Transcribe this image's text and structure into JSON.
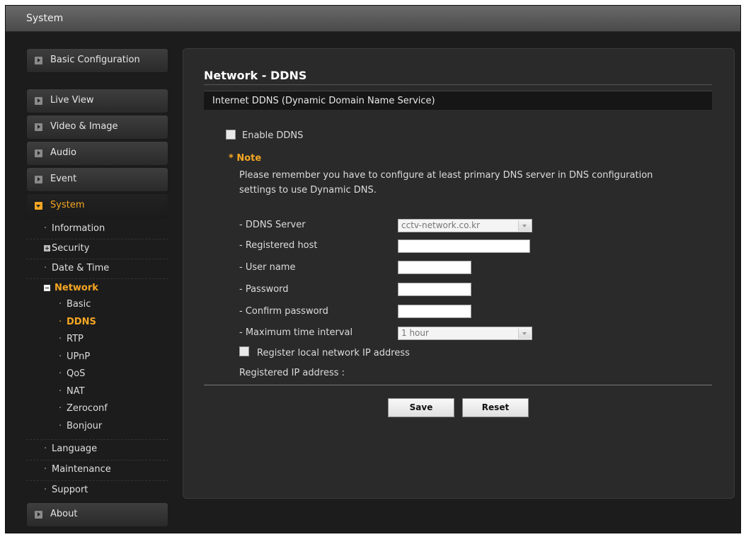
{
  "header": {
    "title": "System"
  },
  "sidebar": {
    "top_items": [
      "Basic Configuration"
    ],
    "items": [
      "Live View",
      "Video & Image",
      "Audio",
      "Event"
    ],
    "active": "System",
    "system_sub": {
      "information": "Information",
      "security": "Security",
      "date_time": "Date & Time",
      "network": "Network",
      "network_sub": [
        "Basic",
        "DDNS",
        "RTP",
        "UPnP",
        "QoS",
        "NAT",
        "Zeroconf",
        "Bonjour"
      ],
      "language": "Language",
      "maintenance": "Maintenance",
      "support": "Support"
    },
    "about": "About"
  },
  "main": {
    "page_title": "Network - DDNS",
    "section_title": "Internet DDNS (Dynamic Domain Name Service)",
    "enable_ddns_label": "Enable DDNS",
    "enable_ddns_checked": false,
    "note_title": "* Note",
    "note_line1": "Please remember you have to configure at least primary DNS server in DNS configuration",
    "note_line2": "settings to use Dynamic DNS.",
    "fields": {
      "ddns_server_label": "- DDNS Server",
      "ddns_server_value": "cctv-network.co.kr",
      "registered_host_label": "- Registered host",
      "registered_host_value": "",
      "user_name_label": "- User name",
      "user_name_value": "",
      "password_label": "- Password",
      "password_value": "",
      "confirm_password_label": "- Confirm password",
      "confirm_password_value": "",
      "max_interval_label": "- Maximum time interval",
      "max_interval_value": "1 hour"
    },
    "register_local_label": "Register local network IP address",
    "register_local_checked": false,
    "registered_ip_label": "Registered IP address :",
    "save_label": "Save",
    "reset_label": "Reset"
  }
}
